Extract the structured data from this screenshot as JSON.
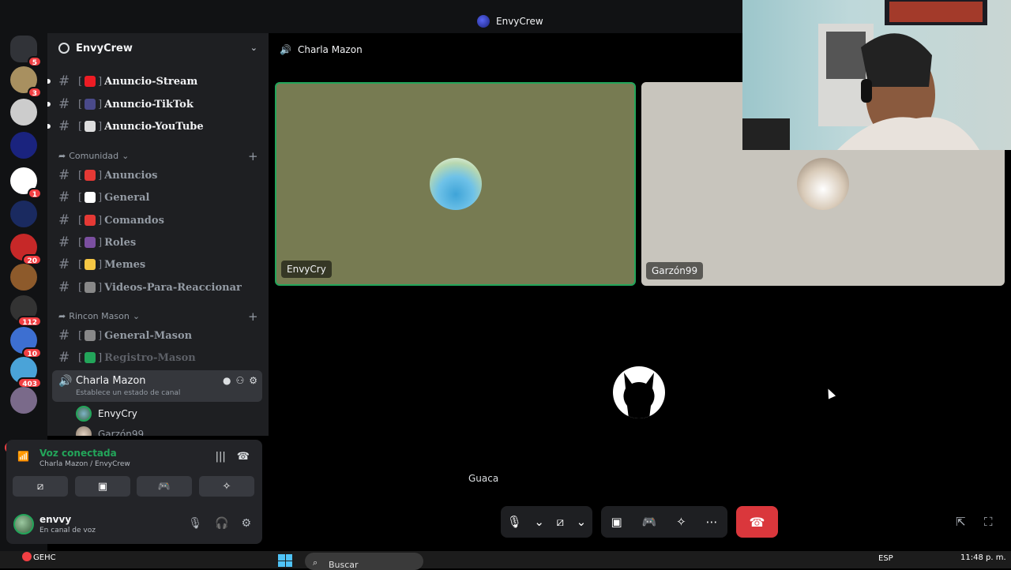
{
  "window": {
    "title": "EnvyCrew"
  },
  "guilds": [
    {
      "name": "discord-home",
      "badge": "5",
      "color": "#313338"
    },
    {
      "name": "server-1",
      "badge": "3",
      "color": "#a89060"
    },
    {
      "name": "server-2",
      "badge": "",
      "color": "#cccccc"
    },
    {
      "name": "envycrew",
      "badge": "",
      "color": "#1a237e"
    },
    {
      "name": "server-4",
      "badge": "1",
      "color": "#ffffff"
    },
    {
      "name": "server-5",
      "badge": "",
      "color": "#1a2a60"
    },
    {
      "name": "server-6",
      "badge": "20",
      "color": "#c62828"
    },
    {
      "name": "server-7",
      "badge": "",
      "color": "#8d5a2b"
    },
    {
      "name": "server-8",
      "badge": "112",
      "color": "#333333"
    },
    {
      "name": "server-9",
      "badge": "10",
      "color": "#3d6fd1"
    },
    {
      "name": "server-10",
      "badge": "403",
      "color": "#4aa3d8"
    },
    {
      "name": "server-11",
      "badge": "",
      "color": "#7a6a8a"
    }
  ],
  "guild_new": "NUEVO",
  "server": {
    "name": "EnvyCrew"
  },
  "channels_top": [
    {
      "name": "Anuncio-Stream",
      "emoji_color": "#ed1c24"
    },
    {
      "name": "Anuncio-TikTok",
      "emoji_color": "#4a4a8a"
    },
    {
      "name": "Anuncio-YouTube",
      "emoji_color": "#dddddd"
    }
  ],
  "category_comunidad": "Comunidad",
  "channels_comunidad": [
    {
      "name": "Anuncios",
      "emoji_color": "#e53935"
    },
    {
      "name": "General",
      "emoji_color": "#ffffff"
    },
    {
      "name": "Comandos",
      "emoji_color": "#e53935"
    },
    {
      "name": "Roles",
      "emoji_color": "#7b4fa0"
    },
    {
      "name": "Memes",
      "emoji_color": "#f6c744"
    },
    {
      "name": "Videos-Para-Reaccionar",
      "emoji_color": "#888888"
    }
  ],
  "category_rincon": "Rincon Mason",
  "channels_rincon": [
    {
      "name": "General-Mason",
      "emoji_color": "#888888"
    },
    {
      "name": "Registro-Mason",
      "emoji_color": "#23a55a"
    }
  ],
  "voice_channel": {
    "name": "Charla Mazon",
    "status": "Establece un estado de canal",
    "users": [
      "EnvyCry",
      "Garzón99"
    ]
  },
  "voice_panel": {
    "status": "Voz conectada",
    "location": "Charla Mazon / EnvyCrew"
  },
  "user": {
    "name": "envvy",
    "status": "En canal de voz"
  },
  "stage": {
    "title": "Charla Mazon",
    "tiles": [
      {
        "label": "EnvyCry"
      },
      {
        "label": "Garzón99"
      }
    ],
    "guaca": "Guaca"
  },
  "taskbar": {
    "weather_name": "GEHC",
    "search": "Buscar",
    "lang": "ESP",
    "time": "11:48 p. m."
  },
  "colors": {
    "accent": "#23a55a",
    "danger": "#da373c",
    "brand": "#5865f2"
  }
}
